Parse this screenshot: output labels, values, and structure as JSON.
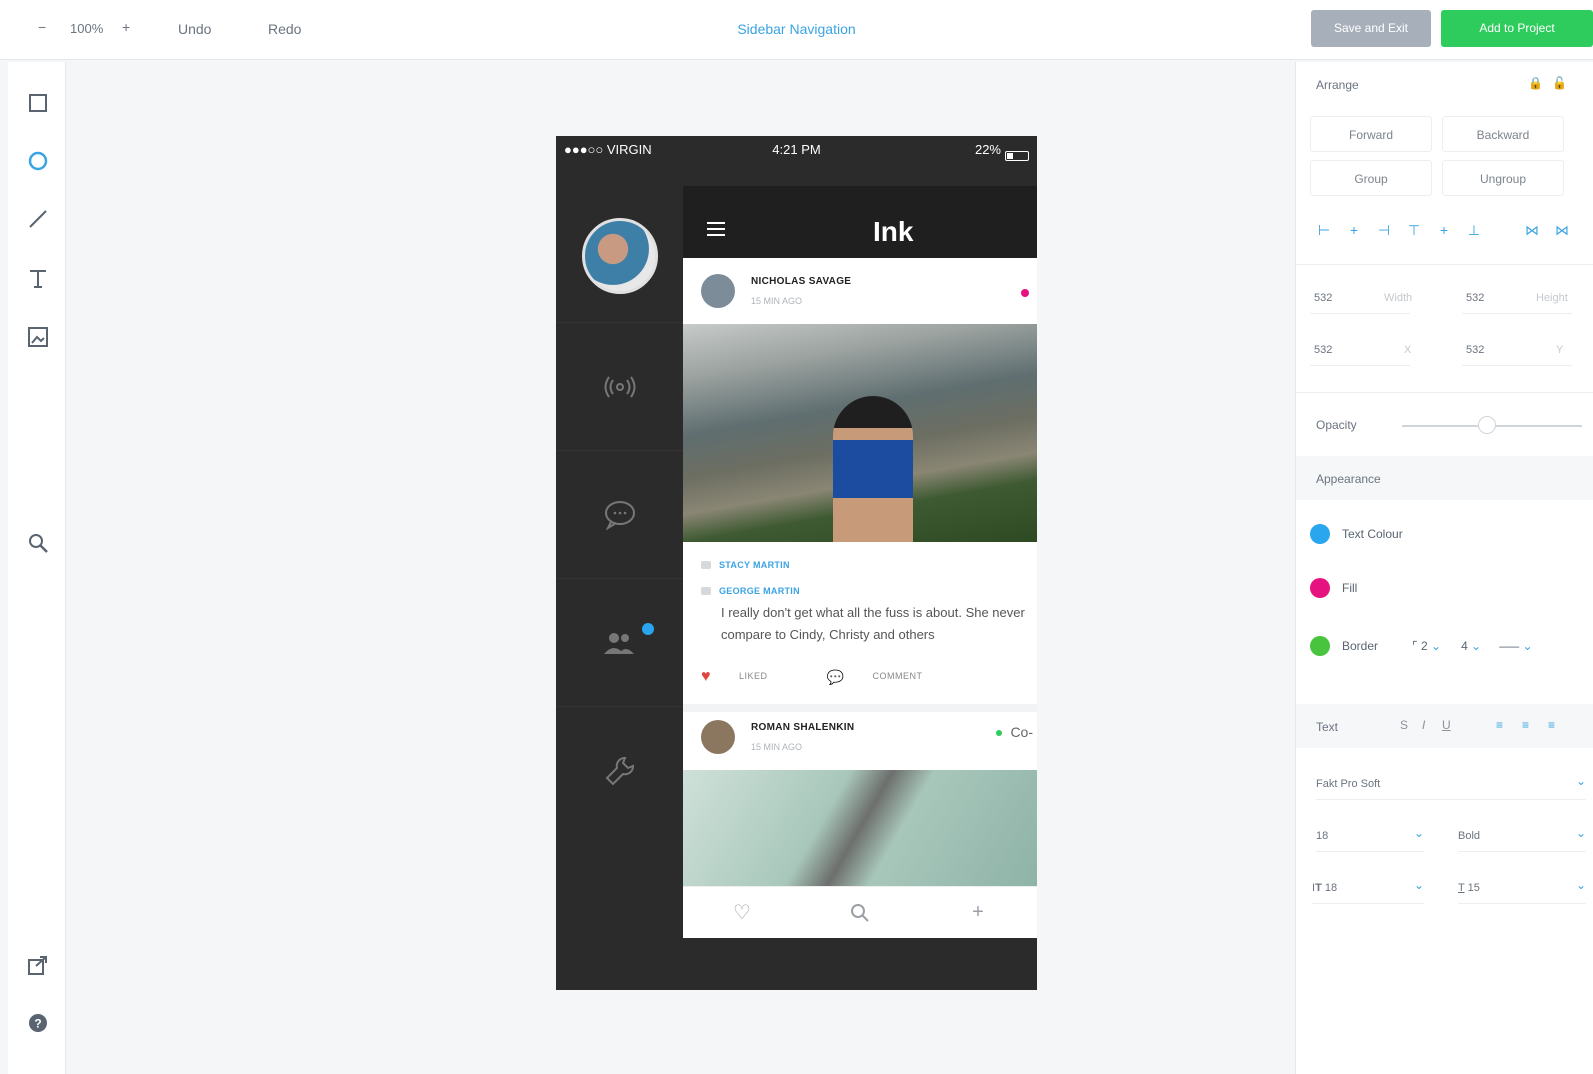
{
  "toolbar": {
    "zoom_minus": "−",
    "zoom_value": "100%",
    "zoom_plus": "+",
    "undo": "Undo",
    "redo": "Redo",
    "doc_title": "Sidebar Navigation",
    "save_exit": "Save and Exit",
    "add_project": "Add to Project"
  },
  "left_tools": [
    "rectangle-tool",
    "ellipse-tool",
    "line-tool",
    "text-tool",
    "image-tool",
    "search-tool",
    "export-tool",
    "help-tool"
  ],
  "phone": {
    "carrier": "●●●○○ VIRGIN",
    "time": "4:21 PM",
    "battery": "22%",
    "app_title": "Ink",
    "post1": {
      "author": "NICHOLAS SAVAGE",
      "time": "15 MIN AGO"
    },
    "comments": [
      {
        "name": "STACY MARTIN"
      },
      {
        "name": "GEORGE MARTIN",
        "text": "I really don't get what all the fuss is about. She never compare to Cindy, Christy and others"
      }
    ],
    "actions": {
      "liked": "LIKED",
      "comment": "COMMENT"
    },
    "post2": {
      "author": "ROMAN SHALENKIN",
      "time": "15 MIN AGO",
      "side_label": "Co-"
    }
  },
  "panel": {
    "arrange": "Arrange",
    "forward": "Forward",
    "backward": "Backward",
    "group": "Group",
    "ungroup": "Ungroup",
    "width_value": "532",
    "width_label": "Width",
    "height_value": "532",
    "height_label": "Height",
    "x_value": "532",
    "x_label": "X",
    "y_value": "532",
    "y_label": "Y",
    "opacity": "Opacity",
    "opacity_level": 0.5,
    "appearance": "Appearance",
    "text_colour": "Text Colour",
    "fill": "Fill",
    "border": "Border",
    "border_radius": "2",
    "border_width": "4",
    "text_section": "Text",
    "font_family": "Fakt Pro Soft",
    "font_size": "18",
    "font_weight": "Bold",
    "line_height": "18",
    "letter_spacing": "15"
  },
  "colors": {
    "accent": "#3aa3e3",
    "add_button": "#2ecc5d",
    "save_button": "#a7b0ba",
    "text_colour_swatch": "#29a6ee",
    "fill_swatch": "#e5127f",
    "border_swatch": "#48c43f"
  }
}
